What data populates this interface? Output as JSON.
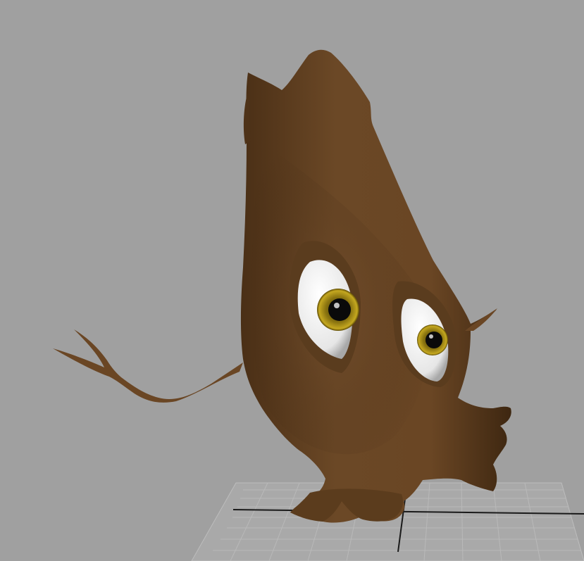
{
  "viewport": {
    "background_color": "#a0a0a0",
    "grid_color": "#b9b9b9",
    "grid_axis_color": "#1a1a1a"
  },
  "character": {
    "body_color": "#664424",
    "eye_white_color": "#ffffff",
    "iris_color": "#8a7a10",
    "pupil_color": "#0a0a0a"
  }
}
